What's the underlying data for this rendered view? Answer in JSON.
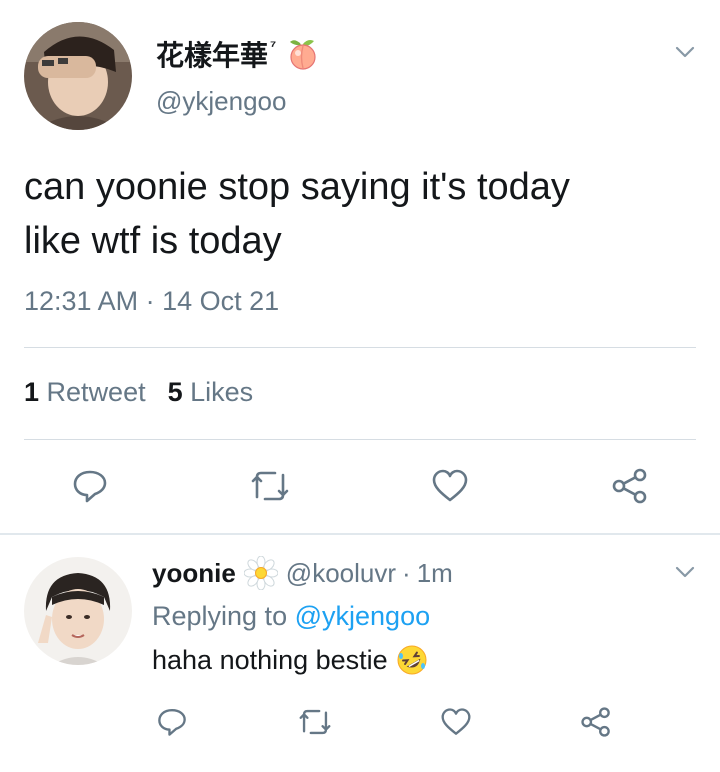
{
  "tweet": {
    "display_name": "花樣年華",
    "name_suffix": "⁷",
    "emoji_icon": "peach-emoji-icon",
    "handle": "@ykjengoo",
    "text_line1": "can yoonie stop saying it's today",
    "text_line2": "like wtf is today",
    "timestamp": "12:31 AM · 14 Oct 21",
    "retweet_count": "1",
    "retweet_label": "Retweet",
    "like_count": "5",
    "like_label": "Likes",
    "actions": [
      "reply-icon",
      "retweet-icon",
      "like-icon",
      "share-icon"
    ]
  },
  "reply": {
    "display_name": "yoonie",
    "emoji_icon": "daisy-emoji-icon",
    "handle": "@kooluvr",
    "separator": "·",
    "time": "1m",
    "replying_prefix": "Replying to",
    "replying_to": "@ykjengoo",
    "text": "haha nothing bestie",
    "text_emoji_icon": "rolling-laughing-emoji-icon",
    "actions": [
      "reply-icon",
      "retweet-icon",
      "like-icon",
      "share-icon"
    ]
  },
  "colors": {
    "text": "#14171a",
    "secondary": "#657786",
    "link": "#1da1f2",
    "divider": "#d6dde3",
    "icon": "#657786"
  }
}
